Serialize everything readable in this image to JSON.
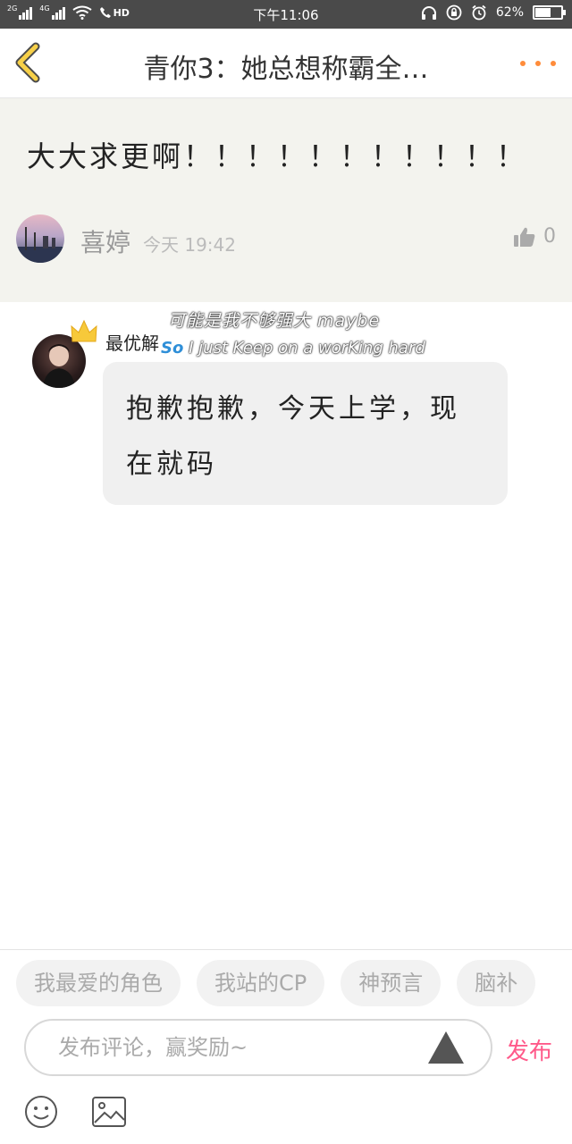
{
  "status_bar": {
    "sim1_label": "2G",
    "sim2_label": "4G",
    "hd_label": "HD",
    "time": "下午11:06",
    "battery_text": "62%",
    "battery_level": 0.62
  },
  "nav": {
    "title": "青你3：她总想称霸全…",
    "back_icon": "chevron-left-icon",
    "more_icon": "more-dots-icon",
    "accent_color": "#ff8c3a"
  },
  "quoted_comment": {
    "text": "大大求更啊！！！！！！！！！！！",
    "username": "喜婷",
    "time": "今天 19:42",
    "like_count": "0",
    "like_icon": "thumbs-up-icon"
  },
  "reply": {
    "badge": "最优解",
    "decoration_line1": "可能是我不够强大 maybe",
    "decoration_line2_prefix": "So",
    "decoration_line2": " I just Keep on a worKing hard",
    "text": "抱歉抱歉，今天上学，现在就码"
  },
  "tags": [
    "我最爱的角色",
    "我站的CP",
    "神预言",
    "脑补"
  ],
  "comment_box": {
    "placeholder": "发布评论，赢奖励~",
    "publish_label": "发布",
    "publish_color": "#ff5a8a"
  },
  "toolbar": {
    "emoji_icon": "emoji-icon",
    "image_icon": "image-icon"
  }
}
